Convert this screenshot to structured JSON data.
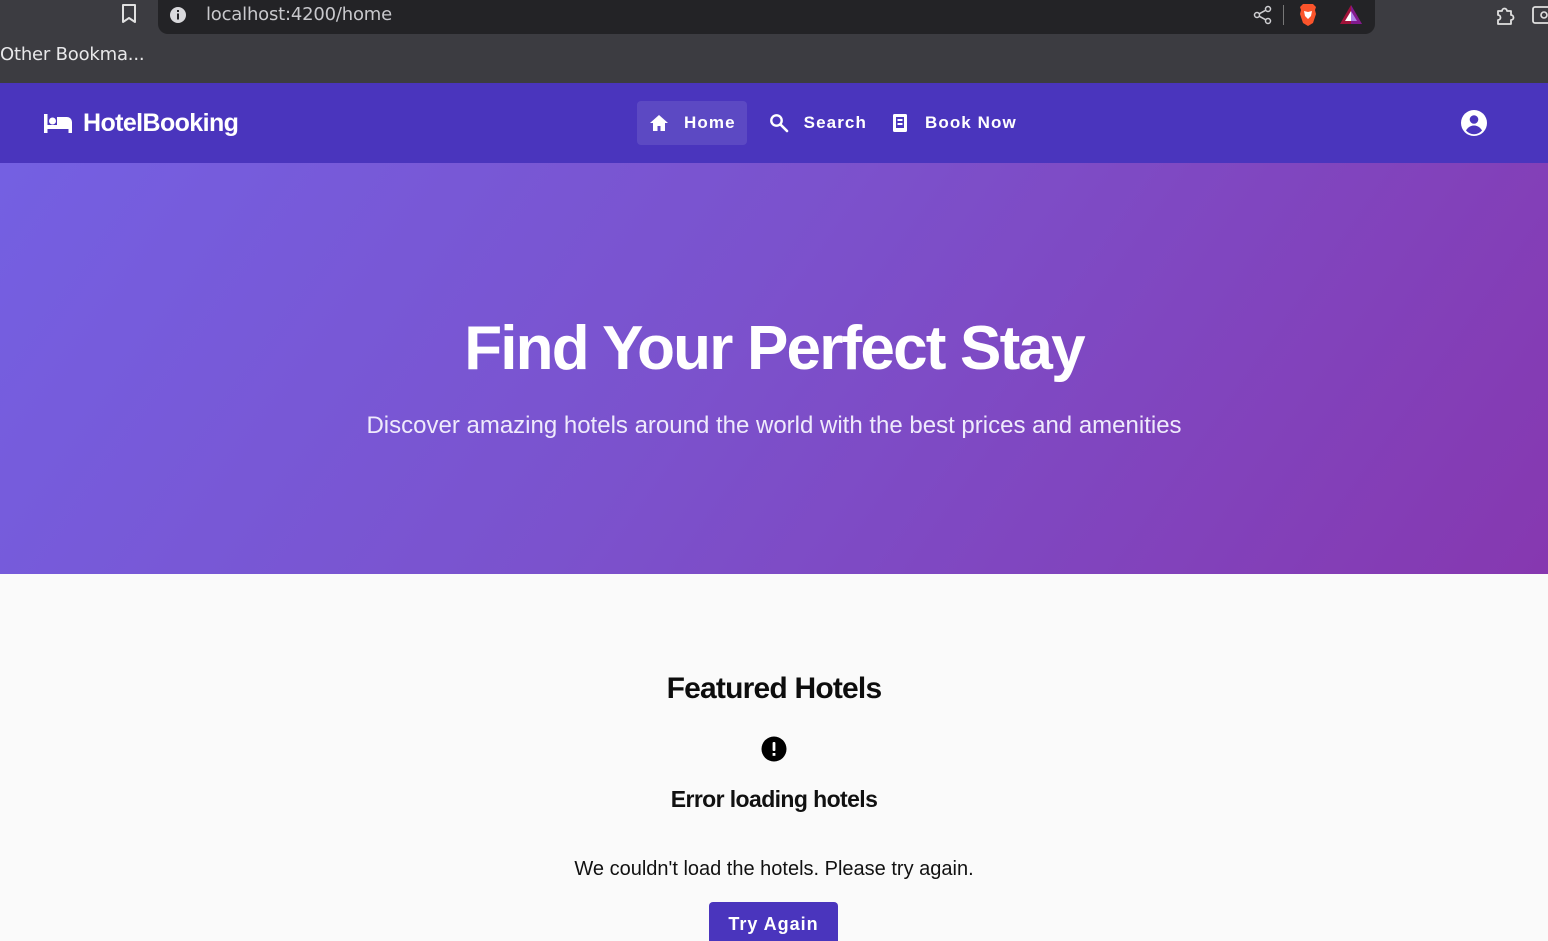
{
  "browser": {
    "url": "localhost:4200/home",
    "bookmarks_bar": "Other Bookma...",
    "icons": [
      "bookmark-icon",
      "info-icon",
      "share-icon",
      "brave-shield-icon",
      "brave-rewards-icon",
      "extensions-icon",
      "reader-mode-icon"
    ]
  },
  "navbar": {
    "brand": "HotelBooking",
    "brand_icon": "bed-icon",
    "items": [
      {
        "label": "Home",
        "icon": "home-icon",
        "active": true
      },
      {
        "label": "Search",
        "icon": "search-icon",
        "active": false
      },
      {
        "label": "Book Now",
        "icon": "book-icon",
        "active": false
      }
    ],
    "account_icon": "account-circle-icon"
  },
  "hero": {
    "title": "Find Your Perfect Stay",
    "subtitle": "Discover amazing hotels around the world with the best prices and amenities"
  },
  "featured": {
    "title": "Featured Hotels",
    "error_icon": "error-icon",
    "error_title": "Error loading hotels",
    "error_message": "We couldn't load the hotels. Please try again.",
    "retry_label": "Try Again"
  },
  "colors": {
    "primary": "#4a35bd",
    "hero_start": "#7460e2",
    "hero_end": "#8638b0",
    "chrome": "#3c3c41"
  }
}
